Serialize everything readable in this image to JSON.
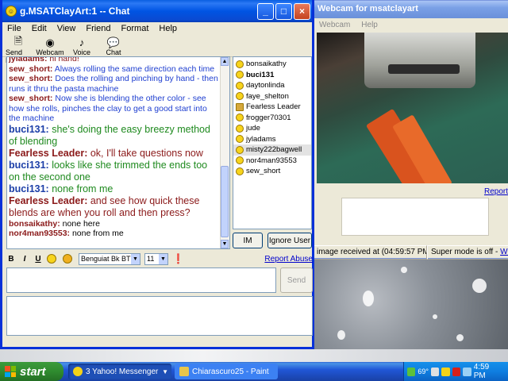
{
  "chat_window": {
    "title": "g.MSATClayArt:1 -- Chat",
    "title_buttons": {
      "minimize": "_",
      "maximize": "□",
      "close": "×"
    },
    "menu": [
      "File",
      "Edit",
      "View",
      "Friend",
      "Format",
      "Help"
    ],
    "toolbar": [
      {
        "label": "Send File",
        "icon": "send-file-icon"
      },
      {
        "label": "Webcam",
        "icon": "webcam-icon"
      },
      {
        "label": "Voice",
        "icon": "microphone-icon"
      },
      {
        "label": "Chat",
        "icon": "chat-icon"
      }
    ],
    "messages": [
      {
        "name": "jyladams:",
        "text": " hi hand!",
        "name_color": "#8b1a1a",
        "text_color": "#8b1a1a",
        "size": "normal"
      },
      {
        "name": "sew_short:",
        "text": " Always rolling the same direction each time",
        "name_color": "#8b1a1a",
        "text_color": "#1f3fd0",
        "size": "normal"
      },
      {
        "name": "sew_short:",
        "text": " Does the rolling and pinching by hand - then runs it thru the pasta machine",
        "name_color": "#8b1a1a",
        "text_color": "#1f3fd0",
        "size": "normal"
      },
      {
        "name": "sew_short:",
        "text": " Now she is blending the other color - see how she rolls, pinches the clay to get a good start into the machine",
        "name_color": "#8b1a1a",
        "text_color": "#1f3fd0",
        "size": "normal"
      },
      {
        "name": "buci131:",
        "text": " she's doing the easy breezy method of blending",
        "name_color": "#1c3fa8",
        "text_color": "#1f8a1f",
        "size": "big"
      },
      {
        "name": "Fearless Leader:",
        "text": " ok, I'll take questions now",
        "name_color": "#8b1a1a",
        "text_color": "#8b1a1a",
        "size": "big"
      },
      {
        "name": "buci131:",
        "text": " looks like she trimmed the ends too on the second one",
        "name_color": "#1c3fa8",
        "text_color": "#1f8a1f",
        "size": "big"
      },
      {
        "name": "buci131:",
        "text": " none from me",
        "name_color": "#1c3fa8",
        "text_color": "#1f8a1f",
        "size": "big"
      },
      {
        "name": "Fearless Leader:",
        "text": " and see how quick these blends are when you roll and then press?",
        "name_color": "#8b1a1a",
        "text_color": "#8b1a1a",
        "size": "big"
      },
      {
        "name": "bonsaikathy:",
        "text": " none here",
        "name_color": "#8b1a1a",
        "text_color": "#000000",
        "size": "normal"
      },
      {
        "name": "nor4man93553:",
        "text": " none from me",
        "name_color": "#8b1a1a",
        "text_color": "#000000",
        "size": "normal"
      }
    ],
    "users": [
      {
        "name": "bonsaikathy",
        "bold": false,
        "selected": false,
        "icon": "smiley-icon"
      },
      {
        "name": "buci131",
        "bold": true,
        "selected": false,
        "icon": "smiley-icon"
      },
      {
        "name": "daytonlinda",
        "bold": false,
        "selected": false,
        "icon": "smiley-icon"
      },
      {
        "name": "faye_shelton",
        "bold": false,
        "selected": false,
        "icon": "smiley-icon"
      },
      {
        "name": "Fearless Leader",
        "bold": false,
        "selected": false,
        "icon": "webcam-user-icon"
      },
      {
        "name": "frogger70301",
        "bold": false,
        "selected": false,
        "icon": "smiley-icon"
      },
      {
        "name": "jude",
        "bold": false,
        "selected": false,
        "icon": "smiley-icon"
      },
      {
        "name": "jyladams",
        "bold": false,
        "selected": false,
        "icon": "smiley-icon"
      },
      {
        "name": "misty222bagwell",
        "bold": false,
        "selected": true,
        "icon": "smiley-icon"
      },
      {
        "name": "nor4man93553",
        "bold": false,
        "selected": false,
        "icon": "smiley-icon"
      },
      {
        "name": "sew_short",
        "bold": false,
        "selected": false,
        "icon": "smiley-icon"
      }
    ],
    "im_button": "IM",
    "ignore_button": "Ignore User",
    "format": {
      "bold": "B",
      "italic": "I",
      "underline": "U",
      "font": "Benguiat Bk BT",
      "size": "11",
      "report_abuse": "Report Abuse"
    },
    "send_button": "Send"
  },
  "webcam_window": {
    "title": "Webcam for msatclayart",
    "menu": [
      "Webcam",
      "Help"
    ],
    "report_link": "Report",
    "status_image": "image received at (04:59:57 PM)",
    "status_super": "Super mode is off -",
    "status_link": "What"
  },
  "taskbar": {
    "start_label": "start",
    "tasks": [
      {
        "label": "3 Yahoo! Messenger",
        "icon": "yahoo-messenger-icon"
      },
      {
        "label": "Chiarascuro25 - Paint",
        "icon": "paint-icon"
      }
    ],
    "tray_temp": "69°",
    "clock": "4:59 PM"
  },
  "colors": {
    "title_blue": "#0054e3",
    "taskbar_blue": "#2157d7",
    "start_green": "#2f8b2f"
  }
}
